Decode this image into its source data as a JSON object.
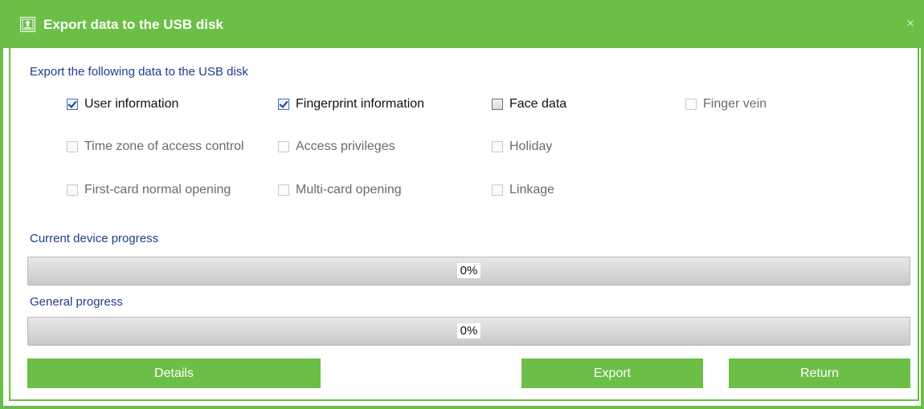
{
  "window": {
    "title": "Export data to the USB disk",
    "close_glyph": "×",
    "accent_color": "#6cbf46"
  },
  "export_section": {
    "heading": "Export the following data to the USB disk",
    "options": [
      {
        "label": "User information",
        "checked": true,
        "enabled": true
      },
      {
        "label": "Fingerprint information",
        "checked": true,
        "enabled": true
      },
      {
        "label": "Face data",
        "checked": false,
        "enabled": true
      },
      {
        "label": "Finger vein",
        "checked": false,
        "enabled": false
      },
      {
        "label": "Time zone of access control",
        "checked": false,
        "enabled": false
      },
      {
        "label": "Access privileges",
        "checked": false,
        "enabled": false
      },
      {
        "label": "Holiday",
        "checked": false,
        "enabled": false
      },
      {
        "label": "First-card normal opening",
        "checked": false,
        "enabled": false
      },
      {
        "label": "Multi-card opening",
        "checked": false,
        "enabled": false
      },
      {
        "label": "Linkage",
        "checked": false,
        "enabled": false
      }
    ]
  },
  "current_progress": {
    "label": "Current device progress",
    "value": 0,
    "text": "0%"
  },
  "general_progress": {
    "label": "General progress",
    "value": 0,
    "text": "0%"
  },
  "buttons": {
    "details": "Details",
    "export": "Export",
    "return": "Return"
  }
}
